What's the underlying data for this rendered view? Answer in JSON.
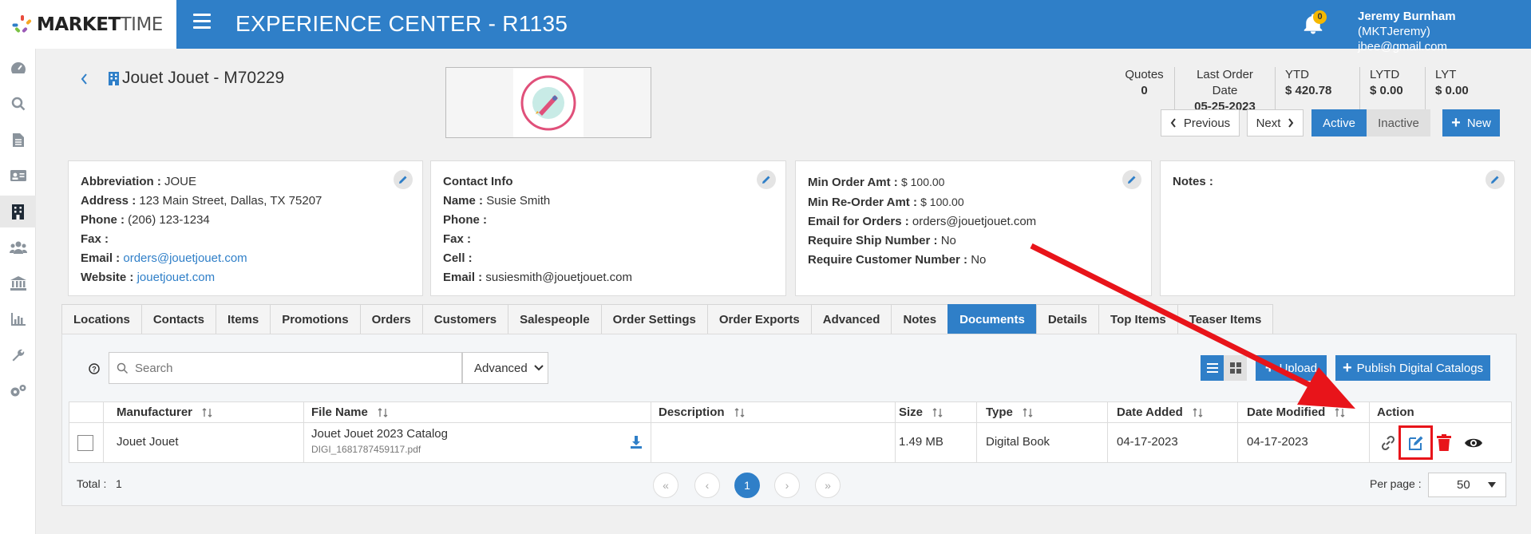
{
  "header": {
    "logo_bold": "MARKET",
    "logo_light": "TIME",
    "title": "EXPERIENCE CENTER - R1135",
    "notifications_count": "0",
    "user_name": "Jeremy Burnham",
    "user_handle": "(MKTJeremy)",
    "user_email": "jbee@gmail.com"
  },
  "sidebar": {
    "icons": [
      "dashboard-icon",
      "search-icon",
      "document-icon",
      "contact-card-icon",
      "building-icon",
      "users-icon",
      "bank-icon",
      "chart-icon",
      "wrench-icon",
      "settings-icon"
    ],
    "active_index": 4
  },
  "entity": {
    "title": "Jouet Jouet - M70229",
    "stats": [
      {
        "label": "Quotes",
        "value": "0"
      },
      {
        "label": "Last Order Date",
        "value": "05-25-2023"
      },
      {
        "label": "YTD",
        "value": "$ 420.78"
      },
      {
        "label": "LYTD",
        "value": "$ 0.00"
      },
      {
        "label": "LYT",
        "value": "$ 0.00"
      }
    ],
    "previous_label": "Previous",
    "next_label": "Next",
    "active_label": "Active",
    "inactive_label": "Inactive",
    "new_label": "New"
  },
  "cards": {
    "general": {
      "abbreviation_label": "Abbreviation :",
      "abbreviation": "JOUE",
      "address_label": "Address :",
      "address": "123 Main Street, Dallas, TX 75207",
      "phone_label": "Phone :",
      "phone": "(206) 123-1234",
      "fax_label": "Fax :",
      "email_label": "Email :",
      "email": "orders@jouetjouet.com",
      "website_label": "Website :",
      "website": "jouetjouet.com"
    },
    "contact": {
      "heading": "Contact Info",
      "name_label": "Name :",
      "name": "Susie Smith",
      "phone_label": "Phone :",
      "fax_label": "Fax :",
      "cell_label": "Cell :",
      "email_label": "Email :",
      "email": "susiesmith@jouetjouet.com"
    },
    "orders": {
      "min_order_label": "Min Order Amt :",
      "min_order": "$ 100.00",
      "min_reorder_label": "Min Re-Order Amt :",
      "min_reorder": "$ 100.00",
      "email_orders_label": "Email for Orders :",
      "email_orders": "orders@jouetjouet.com",
      "ship_number_label": "Require Ship Number :",
      "ship_number": "No",
      "customer_number_label": "Require Customer Number :",
      "customer_number": "No"
    },
    "notes": {
      "label": "Notes :"
    }
  },
  "tabs": [
    "Locations",
    "Contacts",
    "Items",
    "Promotions",
    "Orders",
    "Customers",
    "Salespeople",
    "Order Settings",
    "Order Exports",
    "Advanced",
    "Notes",
    "Documents",
    "Details",
    "Top Items",
    "Teaser Items"
  ],
  "active_tab": "Documents",
  "documents": {
    "search_placeholder": "Search",
    "advanced_label": "Advanced",
    "upload_label": "Upload",
    "publish_label": "Publish Digital Catalogs",
    "columns": [
      "Manufacturer",
      "File Name",
      "Description",
      "Size",
      "Type",
      "Date Added",
      "Date Modified",
      "Action"
    ],
    "rows": [
      {
        "manufacturer": "Jouet Jouet",
        "file_title": "Jouet Jouet 2023 Catalog",
        "file_name": "DIGI_1681787459117.pdf",
        "description": "",
        "size": "1.49 MB",
        "type": "Digital Book",
        "date_added": "04-17-2023",
        "date_modified": "04-17-2023"
      }
    ],
    "total_label": "Total :",
    "total": "1",
    "current_page": "1",
    "per_page_label": "Per page :",
    "per_page": "50"
  },
  "colors": {
    "primary": "#2f7fc8",
    "annotation": "#e8141a",
    "delete": "#e8141a"
  }
}
